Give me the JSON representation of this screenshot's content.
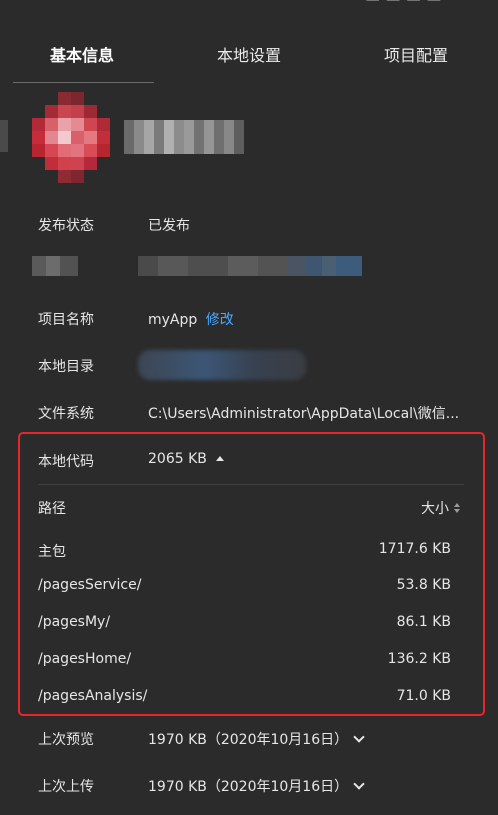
{
  "top_strip": {
    "ghost_text": "—  —  — —"
  },
  "tabs": [
    {
      "label": "基本信息",
      "active": true
    },
    {
      "label": "本地设置",
      "active": false
    },
    {
      "label": "项目配置",
      "active": false
    }
  ],
  "info": {
    "publish_status": {
      "label": "发布状态",
      "value": "已发布"
    },
    "project_name": {
      "label": "项目名称",
      "value": "myApp",
      "action": "修改"
    },
    "local_dir": {
      "label": "本地目录"
    },
    "file_system": {
      "label": "文件系统",
      "value": "C:\\Users\\Administrator\\AppData\\Local\\微信..."
    }
  },
  "local_code": {
    "label": "本地代码",
    "value": "2065 KB",
    "columns": {
      "path": "路径",
      "size": "大小"
    },
    "packages": [
      {
        "path": "主包",
        "size": "1717.6 KB"
      },
      {
        "path": "/pagesService/",
        "size": "53.8 KB"
      },
      {
        "path": "/pagesMy/",
        "size": "86.1 KB"
      },
      {
        "path": "/pagesHome/",
        "size": "136.2 KB"
      },
      {
        "path": "/pagesAnalysis/",
        "size": "71.0 KB"
      }
    ]
  },
  "last_preview": {
    "label": "上次预览",
    "value": "1970 KB（2020年10月16日）"
  },
  "last_upload": {
    "label": "上次上传",
    "value": "1970 KB（2020年10月16日）"
  },
  "colors": {
    "background": "#2b2b2b",
    "link": "#4aa8ff",
    "highlight_border": "#e8262d"
  }
}
